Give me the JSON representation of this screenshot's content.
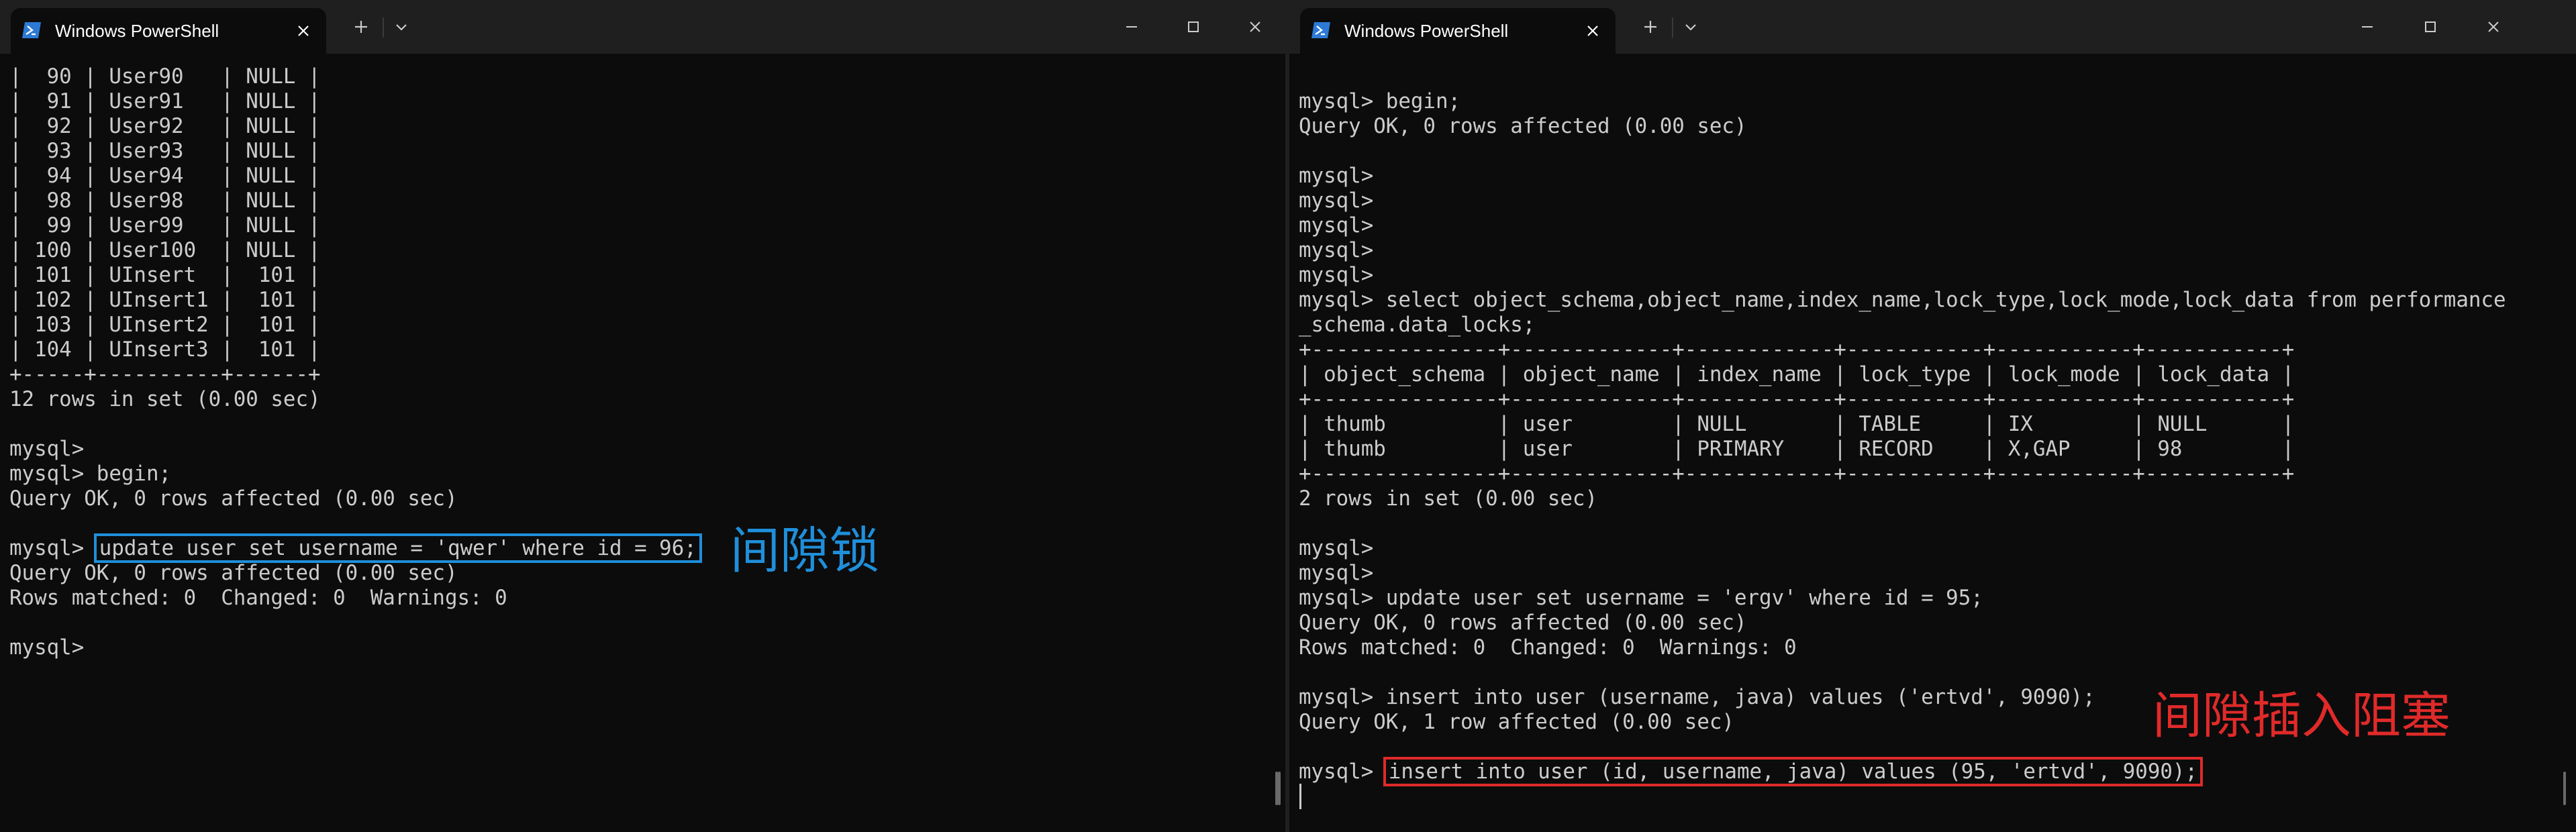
{
  "colors": {
    "background": "#0c0c0c",
    "titlebar": "#1f1f1f",
    "text": "#cccccc",
    "highlight_blue": "#1f8fdb",
    "highlight_red": "#e02a2a",
    "powershell_icon": "#2d7ad6"
  },
  "left_window": {
    "tab_title": "Windows PowerShell",
    "terminal_lines": [
      "|  90 | User90   | NULL |",
      "|  91 | User91   | NULL |",
      "|  92 | User92   | NULL |",
      "|  93 | User93   | NULL |",
      "|  94 | User94   | NULL |",
      "|  98 | User98   | NULL |",
      "|  99 | User99   | NULL |",
      "| 100 | User100  | NULL |",
      "| 101 | UInsert  |  101 |",
      "| 102 | UInsert1 |  101 |",
      "| 103 | UInsert2 |  101 |",
      "| 104 | UInsert3 |  101 |",
      "+-----+----------+------+",
      "12 rows in set (0.00 sec)",
      "",
      "mysql>",
      "mysql> begin;",
      "Query OK, 0 rows affected (0.00 sec)",
      "",
      "",
      "Query OK, 0 rows affected (0.00 sec)",
      "Rows matched: 0  Changed: 0  Warnings: 0",
      "",
      "mysql>"
    ],
    "highlight_prompt": "mysql> ",
    "highlight_command": "update user set username = 'qwer' where id = 96;",
    "annotation": "间隙锁"
  },
  "right_window": {
    "tab_title": "Windows PowerShell",
    "terminal_lines": [
      "",
      "mysql> begin;",
      "Query OK, 0 rows affected (0.00 sec)",
      "",
      "mysql>",
      "mysql>",
      "mysql>",
      "mysql>",
      "mysql>",
      "mysql> select object_schema,object_name,index_name,lock_type,lock_mode,lock_data from performance",
      "_schema.data_locks;",
      "+---------------+-------------+------------+-----------+-----------+-----------+",
      "| object_schema | object_name | index_name | lock_type | lock_mode | lock_data |",
      "+---------------+-------------+------------+-----------+-----------+-----------+",
      "| thumb         | user        | NULL       | TABLE     | IX        | NULL      |",
      "| thumb         | user        | PRIMARY    | RECORD    | X,GAP     | 98        |",
      "+---------------+-------------+------------+-----------+-----------+-----------+",
      "2 rows in set (0.00 sec)",
      "",
      "mysql>",
      "mysql>",
      "mysql> update user set username = 'ergv' where id = 95;",
      "Query OK, 0 rows affected (0.00 sec)",
      "Rows matched: 0  Changed: 0  Warnings: 0",
      "",
      "mysql> insert into user (username, java) values ('ertvd', 9090);",
      "Query OK, 1 row affected (0.00 sec)",
      ""
    ],
    "highlight_prompt": "mysql> ",
    "highlight_command": "insert into user (id, username, java) values (95, 'ertvd', 9090);",
    "annotation": "间隙插入阻塞"
  }
}
